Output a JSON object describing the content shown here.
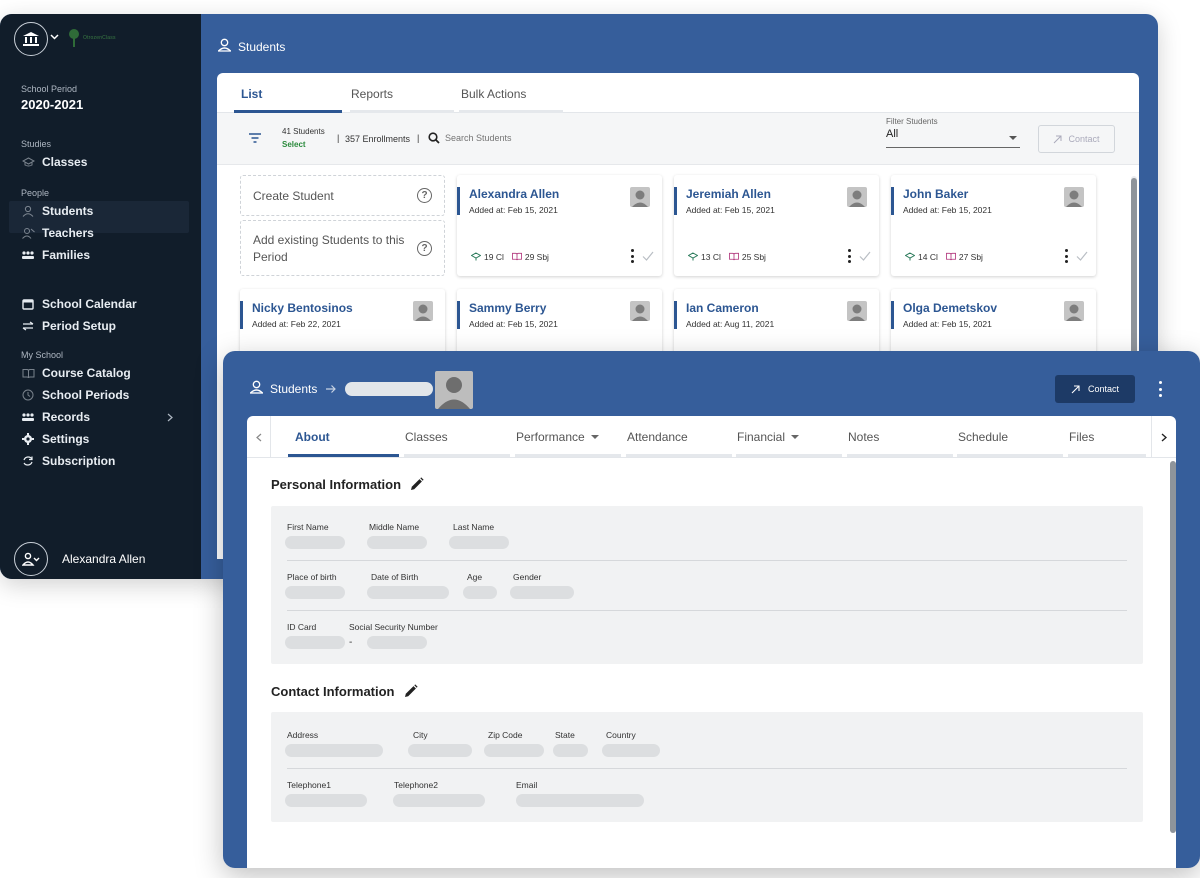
{
  "sidebar": {
    "brand_text": "OtrozenClass",
    "period_label": "School Period",
    "period_value": "2020-2021",
    "studies_label": "Studies",
    "classes": "Classes",
    "people_label": "People",
    "students": "Students",
    "teachers": "Teachers",
    "families": "Families",
    "school_calendar": "School Calendar",
    "period_setup": "Period Setup",
    "my_school_label": "My School",
    "course_catalog": "Course Catalog",
    "school_periods": "School Periods",
    "records": "Records",
    "settings": "Settings",
    "subscription": "Subscription",
    "user_name": "Alexandra Allen"
  },
  "back": {
    "header_title": "Students",
    "tabs": [
      "List",
      "Reports",
      "Bulk Actions"
    ],
    "students_count": "41 Students",
    "select_label": "Select",
    "enrollments": "357 Enrollments",
    "separator": "|",
    "search_placeholder": "Search Students",
    "filter_label": "Filter Students",
    "filter_value": "All",
    "contact_label": "Contact",
    "create_student": "Create Student",
    "add_existing": "Add existing Students to this Period",
    "cards": [
      {
        "name": "Alexandra Allen",
        "added": "Added at: Feb 15, 2021",
        "classes": "19 Cl",
        "subjects": "29 Sbj"
      },
      {
        "name": "Jeremiah Allen",
        "added": "Added at: Feb 15, 2021",
        "classes": "13 Cl",
        "subjects": "25 Sbj"
      },
      {
        "name": "John Baker",
        "added": "Added at: Feb 15, 2021",
        "classes": "14 Cl",
        "subjects": "27 Sbj"
      },
      {
        "name": "Nicky Bentosinos",
        "added": "Added at: Feb 22, 2021"
      },
      {
        "name": "Sammy Berry",
        "added": "Added at: Feb 15, 2021"
      },
      {
        "name": "Ian Cameron",
        "added": "Added at: Aug 11, 2021"
      },
      {
        "name": "Olga Demetskov",
        "added": "Added at: Feb 15, 2021"
      }
    ]
  },
  "front": {
    "header_title": "Students",
    "contact_label": "Contact",
    "tabs": [
      "About",
      "Classes",
      "Performance",
      "Attendance",
      "Financial",
      "Notes",
      "Schedule",
      "Files"
    ],
    "personal_title": "Personal Information",
    "contact_title": "Contact Information",
    "fields": {
      "first_name": "First Name",
      "middle_name": "Middle Name",
      "last_name": "Last Name",
      "place_of_birth": "Place of birth",
      "date_of_birth": "Date of Birth",
      "age": "Age",
      "gender": "Gender",
      "id_card": "ID Card",
      "ssn": "Social Security Number",
      "address": "Address",
      "city": "City",
      "zip_code": "Zip Code",
      "state": "State",
      "country": "Country",
      "telephone1": "Telephone1",
      "telephone2": "Telephone2",
      "email": "Email",
      "dash": "-"
    }
  },
  "colors": {
    "sidebar_bg": "#111d2a",
    "frame_blue": "#365e9b",
    "accent_blue": "#2c5692",
    "select_green": "#2a8a3c",
    "dark_button": "#1d3a66"
  }
}
